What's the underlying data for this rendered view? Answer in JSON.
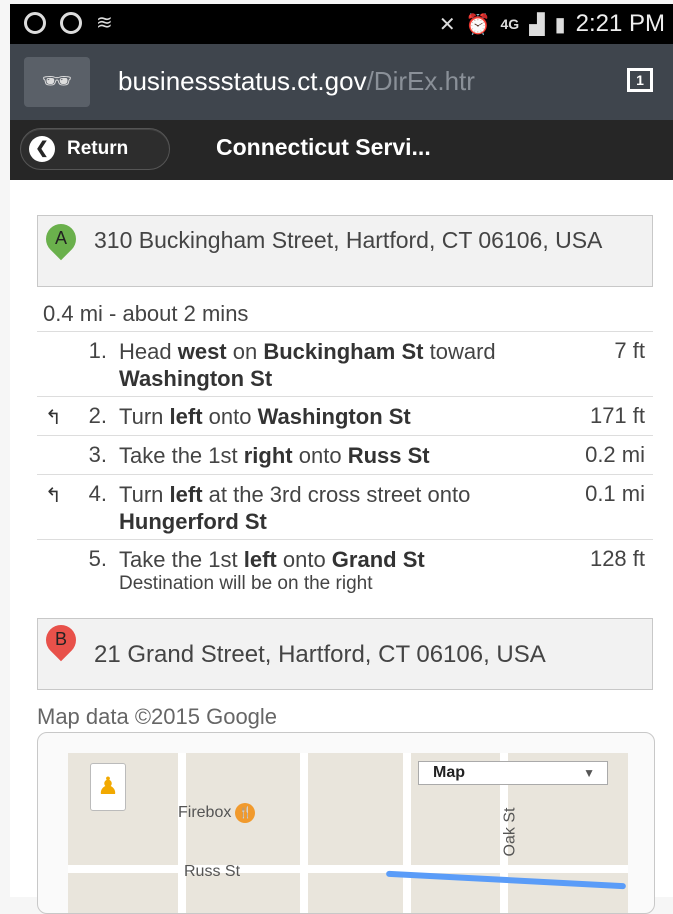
{
  "status_bar": {
    "time": "2:21 PM",
    "network": "4G"
  },
  "browser": {
    "url_main": "businessstatus.ct.gov",
    "url_rest": "/DirEx.htr",
    "tab_count": "1"
  },
  "header": {
    "return_label": "Return",
    "title": "Connecticut Servi..."
  },
  "start": {
    "marker": "A",
    "address": "310 Buckingham Street, Hartford, CT 06106, USA"
  },
  "summary": "0.4 mi - about 2 mins",
  "steps": [
    {
      "num": "1.",
      "parts": [
        "Head ",
        "west",
        " on ",
        "Buckingham St",
        " toward ",
        "Washington St"
      ],
      "dist": "7 ft",
      "turn": ""
    },
    {
      "num": "2.",
      "parts": [
        "Turn ",
        "left",
        " onto ",
        "Washington St"
      ],
      "dist": "171 ft",
      "turn": "left"
    },
    {
      "num": "3.",
      "parts": [
        "Take the 1st ",
        "right",
        " onto ",
        "Russ St"
      ],
      "dist": "0.2 mi",
      "turn": ""
    },
    {
      "num": "4.",
      "parts": [
        "Turn ",
        "left",
        " at the 3rd cross street onto ",
        "Hungerford St"
      ],
      "dist": "0.1 mi",
      "turn": "left"
    },
    {
      "num": "5.",
      "parts": [
        "Take the 1st ",
        "left",
        " onto ",
        "Grand St"
      ],
      "dist": "128 ft",
      "turn": "",
      "note": "Destination will be on the right"
    }
  ],
  "end": {
    "marker": "B",
    "address": "21 Grand Street, Hartford, CT 06106, USA"
  },
  "map": {
    "attribution": "Map data ©2015 Google",
    "map_type": "Map",
    "labels": {
      "poi": "Firebox",
      "street1": "Russ St",
      "street2": "Oak St"
    }
  },
  "colors": {
    "marker_a": "#6ab04c",
    "marker_b": "#e8514a",
    "route": "#5a9cf8"
  }
}
